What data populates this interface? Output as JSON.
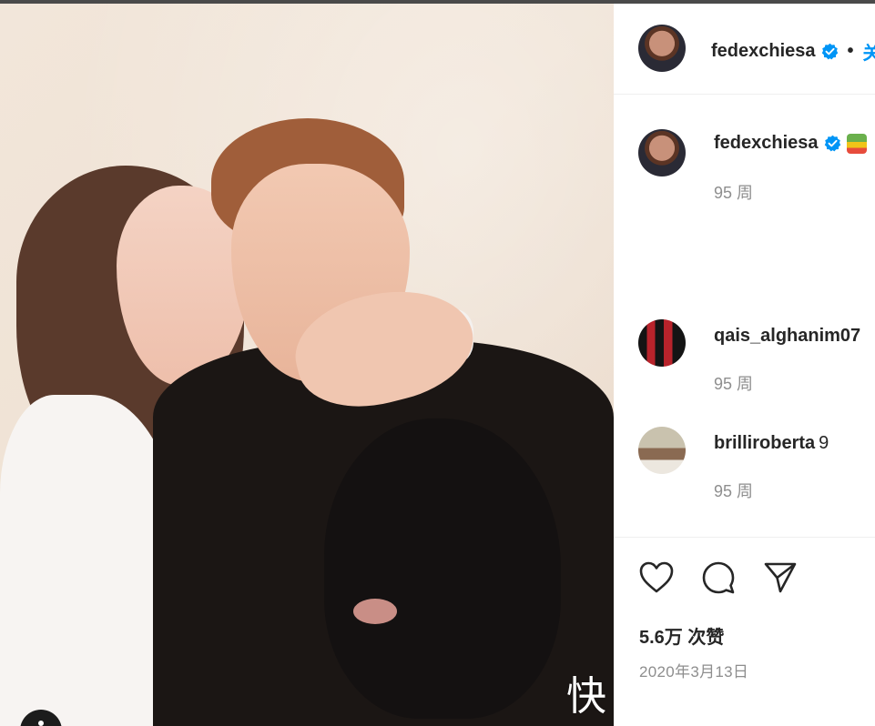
{
  "post": {
    "username": "fedexchiesa",
    "follow_fragment": "•",
    "follow_button_fragment": "关"
  },
  "caption": {
    "username": "fedexchiesa",
    "time": "95 周"
  },
  "comments": [
    {
      "username": "qais_alghanim07",
      "text": "",
      "time": "95 周"
    },
    {
      "username": "brilliroberta",
      "text": "9",
      "time": "95 周"
    }
  ],
  "likes": "5.6万 次赞",
  "date": "2020年3月13日",
  "watermark": "快",
  "icons": {
    "like": "heart-icon",
    "comment": "comment-icon",
    "share": "paper-plane-icon",
    "verified": "verified-badge-icon",
    "photo_tags": "user-tag-icon"
  },
  "colors": {
    "verified": "#0095f6",
    "muted": "#8e8e8e",
    "text": "#262626"
  }
}
